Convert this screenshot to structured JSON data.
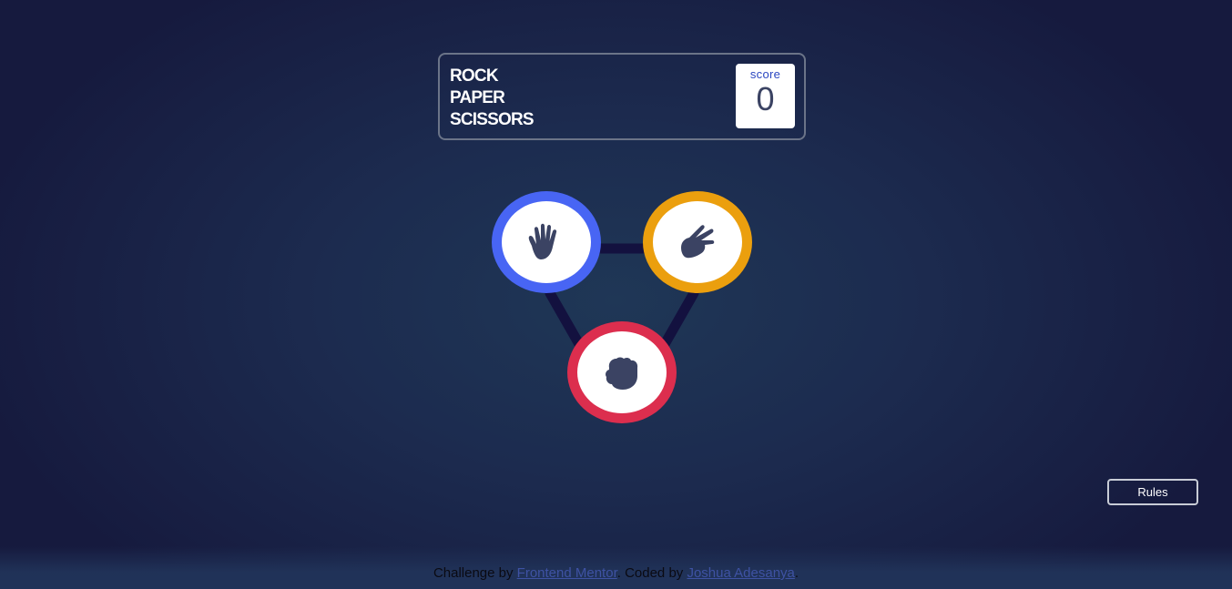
{
  "header": {
    "title_lines": [
      "ROCK",
      "PAPER",
      "SCISSORS"
    ],
    "score_label": "score",
    "score_value": "0"
  },
  "choices": [
    {
      "name": "paper",
      "icon": "paper-hand-icon",
      "ring_color": "#4865f4"
    },
    {
      "name": "scissors",
      "icon": "scissors-hand-icon",
      "ring_color": "#eb9f0e"
    },
    {
      "name": "rock",
      "icon": "rock-fist-icon",
      "ring_color": "#dc2e4e"
    }
  ],
  "rules_button": {
    "label": "Rules"
  },
  "footer": {
    "prefix": "Challenge by ",
    "link1": "Frontend Mentor",
    "middle": ". Coded by ",
    "link2": "Joshua Adesanya",
    "suffix": "."
  },
  "colors": {
    "background": "#1f3756",
    "connector": "#13113f",
    "icon": "#3b4363",
    "score_text": "#2a46c0"
  }
}
